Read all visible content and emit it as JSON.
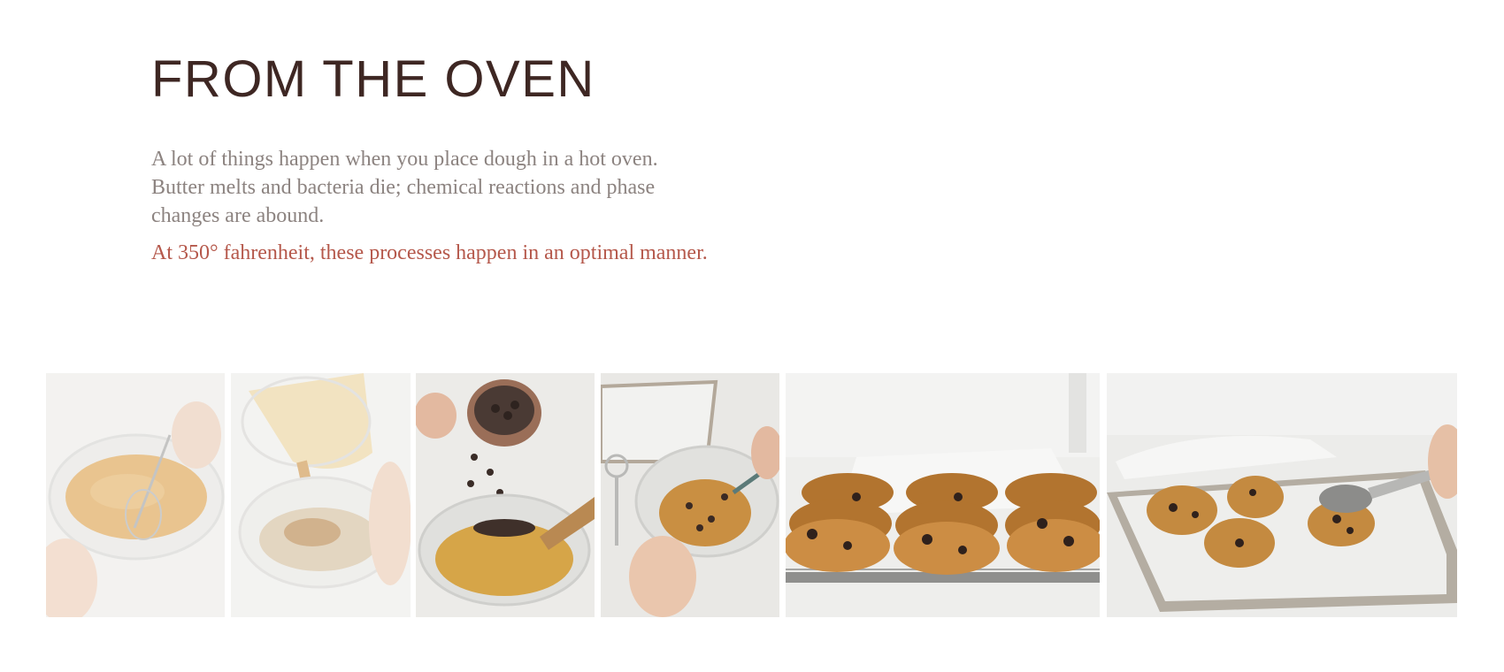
{
  "section": {
    "title": "FROM THE OVEN",
    "body": "A lot of things happen when you place dough in a hot oven. Butter melts and bacteria die; chemical reactions and phase changes are abound.",
    "highlight": "At 350° fahrenheit, these processes happen in an optimal manner."
  },
  "gallery": {
    "photos": [
      {
        "name": "whisking-batter-photo"
      },
      {
        "name": "pouring-batter-photo"
      },
      {
        "name": "adding-chocolate-chips-photo"
      },
      {
        "name": "mixing-dough-photo"
      },
      {
        "name": "cooling-rack-cookies-photo"
      },
      {
        "name": "scooping-dough-photo"
      }
    ]
  },
  "colors": {
    "title": "#3e2723",
    "body": "#8c8380",
    "highlight": "#b5584b",
    "background": "#ffffff"
  }
}
